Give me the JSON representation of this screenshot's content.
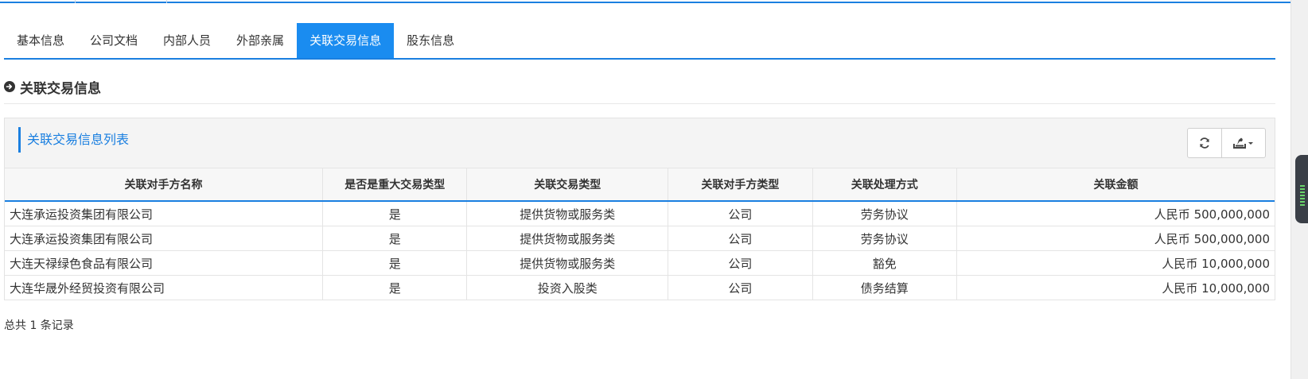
{
  "tabs": [
    {
      "label": "基本信息",
      "active": false
    },
    {
      "label": "公司文档",
      "active": false
    },
    {
      "label": "内部人员",
      "active": false
    },
    {
      "label": "外部亲属",
      "active": false
    },
    {
      "label": "关联交易信息",
      "active": true
    },
    {
      "label": "股东信息",
      "active": false
    }
  ],
  "section": {
    "title": "关联交易信息",
    "icon": "circle-arrow-right-icon"
  },
  "panel": {
    "title": "关联交易信息列表",
    "buttons": {
      "refresh_icon": "refresh-icon",
      "export_icon": "export-dropdown-icon"
    }
  },
  "table": {
    "columns": [
      "关联对手方名称",
      "是否是重大交易类型",
      "关联交易类型",
      "关联对手方类型",
      "关联处理方式",
      "关联金额"
    ],
    "rows": [
      [
        "大连承运投资集团有限公司",
        "是",
        "提供货物或服务类",
        "公司",
        "劳务协议",
        "人民币 500,000,000"
      ],
      [
        "大连承运投资集团有限公司",
        "是",
        "提供货物或服务类",
        "公司",
        "劳务协议",
        "人民币 500,000,000"
      ],
      [
        "大连天禄绿色食品有限公司",
        "是",
        "提供货物或服务类",
        "公司",
        "豁免",
        "人民币 10,000,000"
      ],
      [
        "大连华晟外经贸投资有限公司",
        "是",
        "投资入股类",
        "公司",
        "债务结算",
        "人民币 10,000,000"
      ]
    ]
  },
  "footer": {
    "record_count_text": "总共 1 条记录"
  },
  "colors": {
    "accent": "#1a7fe0",
    "active_tab": "#1a8cf0"
  }
}
